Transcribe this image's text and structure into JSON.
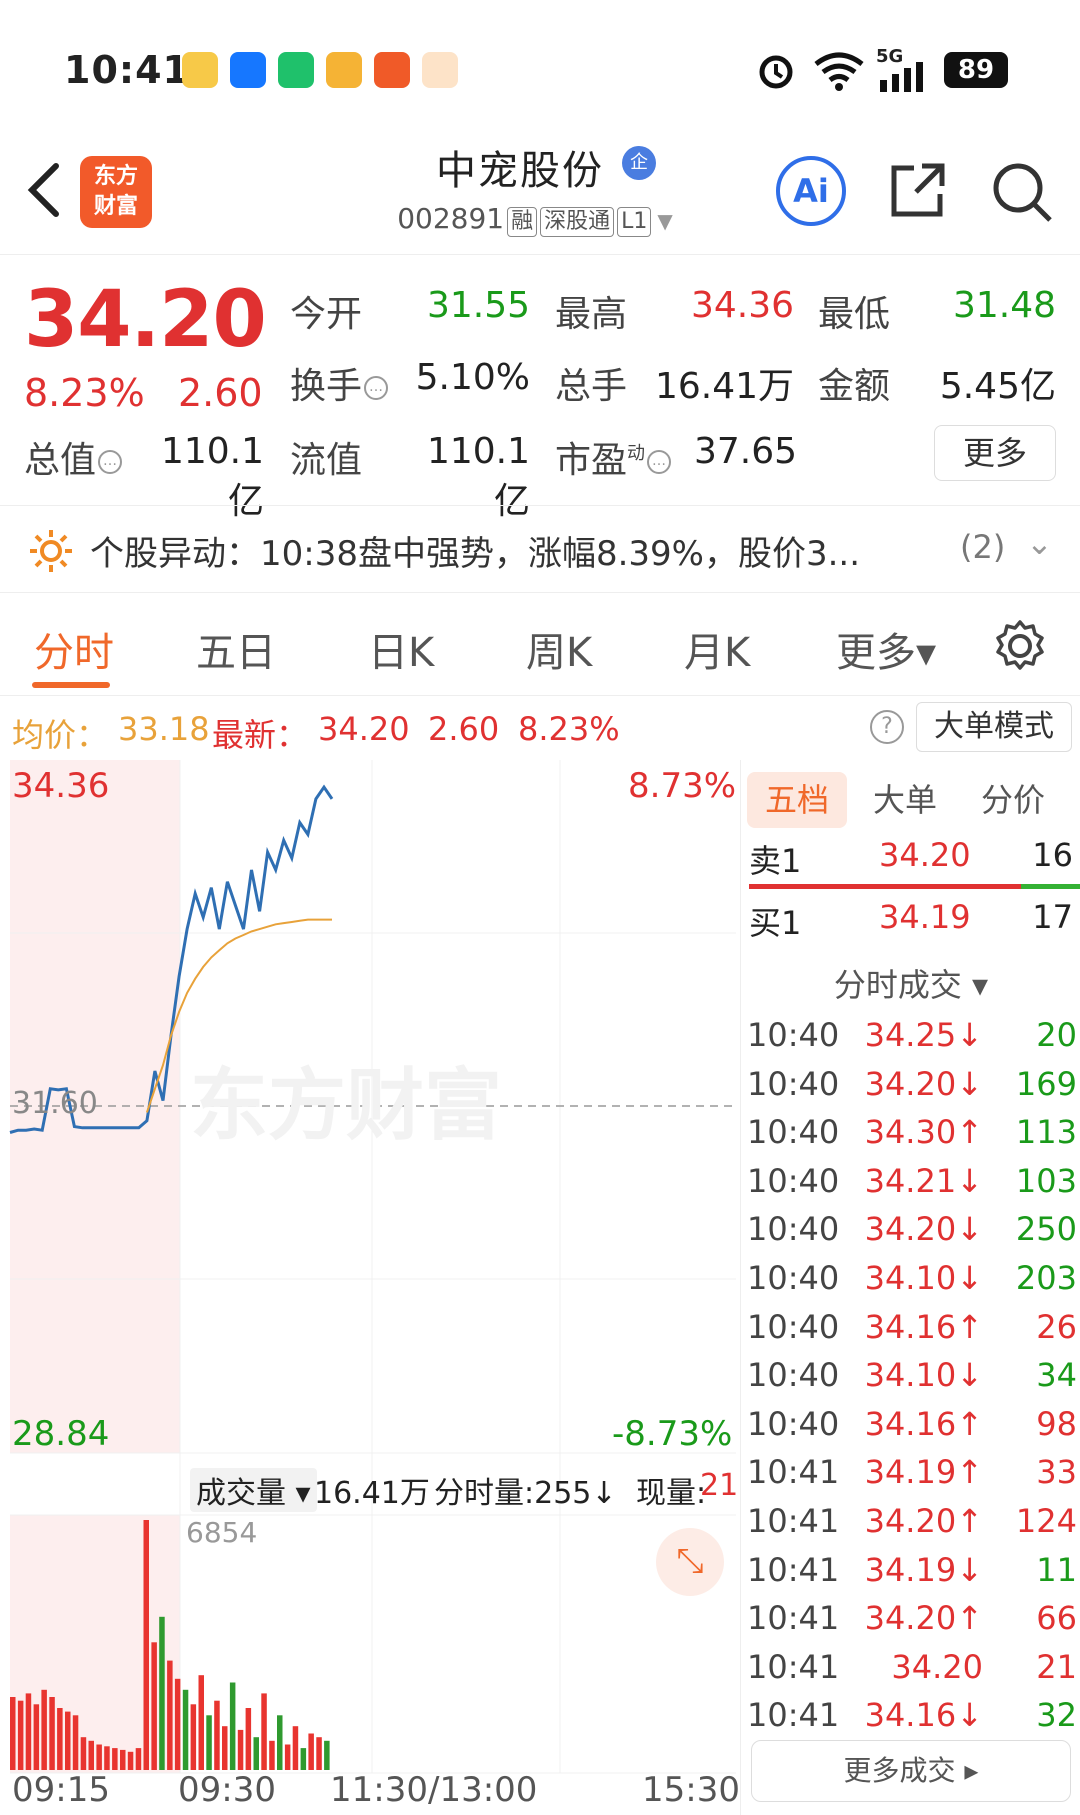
{
  "status_bar": {
    "time": "10:41",
    "network": "5G",
    "battery": "89"
  },
  "header": {
    "app_logo": "东方\n财富",
    "stock_name": "中宠股份",
    "badge": "企",
    "stock_code": "002891",
    "tags": [
      "融",
      "深股通",
      "L1"
    ],
    "ai_label": "Ai"
  },
  "quote": {
    "price": "34.20",
    "change_pct": "8.23%",
    "change_abs": "2.60",
    "open_label": "今开",
    "open": "31.55",
    "high_label": "最高",
    "high": "34.36",
    "low_label": "最低",
    "low": "31.48",
    "turnover_label": "换手",
    "turnover": "5.10%",
    "volume_label": "总手",
    "volume": "16.41万",
    "amount_label": "金额",
    "amount": "5.45亿",
    "mktcap_label": "总值",
    "mktcap": "110.1亿",
    "float_label": "流值",
    "float": "110.1亿",
    "pe_label": "市盈",
    "pe_sup": "动",
    "pe": "37.65",
    "more_label": "更多"
  },
  "alert": {
    "text": "个股异动：10:38盘中强势，涨幅8.39%，股价3...",
    "count": "(2)"
  },
  "tabs": [
    "分时",
    "五日",
    "日K",
    "周K",
    "月K",
    "更多▾"
  ],
  "info_line": {
    "avg_label": "均价：",
    "avg": "33.18",
    "latest_label": "最新：",
    "latest": "34.20",
    "latest_chg": "2.60",
    "latest_pct": "8.23%",
    "bigmode_label": "大单模式"
  },
  "chart": {
    "y_max": "34.36",
    "y_ref": "31.60",
    "y_min": "28.84",
    "pct_max": "8.73%",
    "pct_min": "-8.73%",
    "watermark": "东方财富",
    "volume_label": "成交量",
    "total_volume": "16.41万",
    "period_volume": "分时量:255↓",
    "current_volume_label": "现量:",
    "current_volume": "21",
    "volume_max": "6854",
    "x_labels": [
      "09:15",
      "09:30",
      "11:30/13:00",
      "15:30"
    ]
  },
  "chart_data": {
    "type": "line",
    "title": "",
    "ylim": [
      28.84,
      34.36
    ],
    "reference_price": 31.6,
    "series": [
      {
        "values": [
          31.38,
          31.4,
          31.4,
          31.41,
          31.4,
          31.75,
          31.74,
          31.75,
          31.43,
          31.42,
          31.42,
          31.42,
          31.42,
          31.42,
          31.42,
          31.42,
          31.42,
          31.48,
          31.9,
          31.65,
          32.2,
          32.7,
          33.1,
          33.4,
          33.2,
          33.45,
          33.1,
          33.5,
          33.3,
          33.1,
          33.6,
          33.25,
          33.75,
          33.6,
          33.85,
          33.7,
          34.0,
          33.9,
          34.2,
          34.3,
          34.2
        ]
      },
      {
        "values": [
          null,
          null,
          null,
          null,
          null,
          null,
          null,
          null,
          null,
          null,
          null,
          null,
          null,
          null,
          null,
          null,
          null,
          31.55,
          31.75,
          31.95,
          32.2,
          32.4,
          32.56,
          32.68,
          32.78,
          32.86,
          32.92,
          32.98,
          33.02,
          33.05,
          33.08,
          33.1,
          33.12,
          33.14,
          33.15,
          33.16,
          33.17,
          33.18,
          33.18,
          33.18,
          33.18
        ]
      }
    ],
    "volume_series": [
      {
        "name": "成交量",
        "values": [
          2000,
          1900,
          2100,
          1800,
          2200,
          2000,
          1700,
          1600,
          1500,
          900,
          800,
          700,
          650,
          600,
          550,
          500,
          600,
          6854,
          3500,
          4200,
          3000,
          2500,
          2200,
          1800,
          2600,
          1500,
          1900,
          1200,
          2400,
          1100,
          1700,
          900,
          2100,
          800,
          1500,
          700,
          1200,
          600,
          1000,
          900,
          800
        ]
      }
    ]
  },
  "panel": {
    "tabs": [
      "五档",
      "大单",
      "分价"
    ],
    "sell_label": "卖1",
    "sell_price": "34.20",
    "sell_vol": "16",
    "buy_label": "买1",
    "buy_price": "34.19",
    "buy_vol": "17",
    "ticks_header": "分时成交 ▾",
    "ticks": [
      {
        "time": "10:40",
        "price": "34.25↓",
        "vol": "20",
        "dir": "down"
      },
      {
        "time": "10:40",
        "price": "34.20↓",
        "vol": "169",
        "dir": "down"
      },
      {
        "time": "10:40",
        "price": "34.30↑",
        "vol": "113",
        "dir": "down"
      },
      {
        "time": "10:40",
        "price": "34.21↓",
        "vol": "103",
        "dir": "down"
      },
      {
        "time": "10:40",
        "price": "34.20↓",
        "vol": "250",
        "dir": "down"
      },
      {
        "time": "10:40",
        "price": "34.10↓",
        "vol": "203",
        "dir": "down"
      },
      {
        "time": "10:40",
        "price": "34.16↑",
        "vol": "26",
        "dir": "up"
      },
      {
        "time": "10:40",
        "price": "34.10↓",
        "vol": "34",
        "dir": "down"
      },
      {
        "time": "10:40",
        "price": "34.16↑",
        "vol": "98",
        "dir": "up"
      },
      {
        "time": "10:41",
        "price": "34.19↑",
        "vol": "33",
        "dir": "up"
      },
      {
        "time": "10:41",
        "price": "34.20↑",
        "vol": "124",
        "dir": "up"
      },
      {
        "time": "10:41",
        "price": "34.19↓",
        "vol": "11",
        "dir": "down"
      },
      {
        "time": "10:41",
        "price": "34.20↑",
        "vol": "66",
        "dir": "up"
      },
      {
        "time": "10:41",
        "price": "34.20",
        "vol": "21",
        "dir": "up"
      },
      {
        "time": "10:41",
        "price": "34.16↓",
        "vol": "32",
        "dir": "down"
      }
    ],
    "more_ticks_label": "更多成交 ▸"
  },
  "colors": {
    "up": "#e03131",
    "down": "#1a9a1a",
    "accent": "#f0682a",
    "price_line": "#2f6fb3",
    "avg_line": "#e8a23a"
  }
}
